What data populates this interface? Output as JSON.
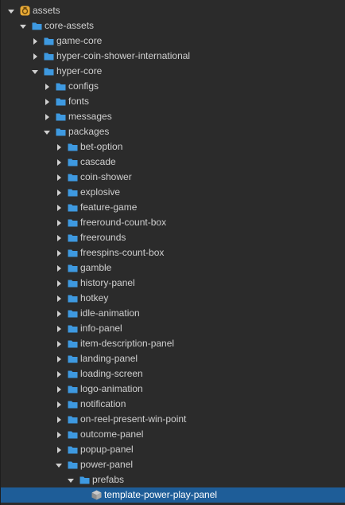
{
  "colors": {
    "background": "#2b2b2b",
    "text": "#cfcfcf",
    "folder": "#3e99e0",
    "selected_row": "#1e5d98",
    "root_icon": "#e8a935"
  },
  "tree": [
    {
      "label": "assets",
      "depth": 0,
      "expanded": true,
      "icon": "assets-root-icon"
    },
    {
      "label": "core-assets",
      "depth": 1,
      "expanded": true,
      "icon": "folder-icon"
    },
    {
      "label": "game-core",
      "depth": 2,
      "expanded": false,
      "icon": "folder-icon"
    },
    {
      "label": "hyper-coin-shower-international",
      "depth": 2,
      "expanded": false,
      "icon": "folder-icon"
    },
    {
      "label": "hyper-core",
      "depth": 2,
      "expanded": true,
      "icon": "folder-icon"
    },
    {
      "label": "configs",
      "depth": 3,
      "expanded": false,
      "icon": "folder-icon"
    },
    {
      "label": "fonts",
      "depth": 3,
      "expanded": false,
      "icon": "folder-icon"
    },
    {
      "label": "messages",
      "depth": 3,
      "expanded": false,
      "icon": "folder-icon"
    },
    {
      "label": "packages",
      "depth": 3,
      "expanded": true,
      "icon": "folder-icon"
    },
    {
      "label": "bet-option",
      "depth": 4,
      "expanded": false,
      "icon": "folder-icon"
    },
    {
      "label": "cascade",
      "depth": 4,
      "expanded": false,
      "icon": "folder-icon"
    },
    {
      "label": "coin-shower",
      "depth": 4,
      "expanded": false,
      "icon": "folder-icon"
    },
    {
      "label": "explosive",
      "depth": 4,
      "expanded": false,
      "icon": "folder-icon"
    },
    {
      "label": "feature-game",
      "depth": 4,
      "expanded": false,
      "icon": "folder-icon"
    },
    {
      "label": "freeround-count-box",
      "depth": 4,
      "expanded": false,
      "icon": "folder-icon"
    },
    {
      "label": "freerounds",
      "depth": 4,
      "expanded": false,
      "icon": "folder-icon"
    },
    {
      "label": "freespins-count-box",
      "depth": 4,
      "expanded": false,
      "icon": "folder-icon"
    },
    {
      "label": "gamble",
      "depth": 4,
      "expanded": false,
      "icon": "folder-icon"
    },
    {
      "label": "history-panel",
      "depth": 4,
      "expanded": false,
      "icon": "folder-icon"
    },
    {
      "label": "hotkey",
      "depth": 4,
      "expanded": false,
      "icon": "folder-icon"
    },
    {
      "label": "idle-animation",
      "depth": 4,
      "expanded": false,
      "icon": "folder-icon"
    },
    {
      "label": "info-panel",
      "depth": 4,
      "expanded": false,
      "icon": "folder-icon"
    },
    {
      "label": "item-description-panel",
      "depth": 4,
      "expanded": false,
      "icon": "folder-icon"
    },
    {
      "label": "landing-panel",
      "depth": 4,
      "expanded": false,
      "icon": "folder-icon"
    },
    {
      "label": "loading-screen",
      "depth": 4,
      "expanded": false,
      "icon": "folder-icon"
    },
    {
      "label": "logo-animation",
      "depth": 4,
      "expanded": false,
      "icon": "folder-icon"
    },
    {
      "label": "notification",
      "depth": 4,
      "expanded": false,
      "icon": "folder-icon"
    },
    {
      "label": "on-reel-present-win-point",
      "depth": 4,
      "expanded": false,
      "icon": "folder-icon"
    },
    {
      "label": "outcome-panel",
      "depth": 4,
      "expanded": false,
      "icon": "folder-icon"
    },
    {
      "label": "popup-panel",
      "depth": 4,
      "expanded": false,
      "icon": "folder-icon"
    },
    {
      "label": "power-panel",
      "depth": 4,
      "expanded": true,
      "icon": "folder-icon"
    },
    {
      "label": "prefabs",
      "depth": 5,
      "expanded": true,
      "icon": "folder-icon"
    },
    {
      "label": "template-power-play-panel",
      "depth": 6,
      "leaf": true,
      "selected": true,
      "icon": "prefab-icon"
    }
  ]
}
